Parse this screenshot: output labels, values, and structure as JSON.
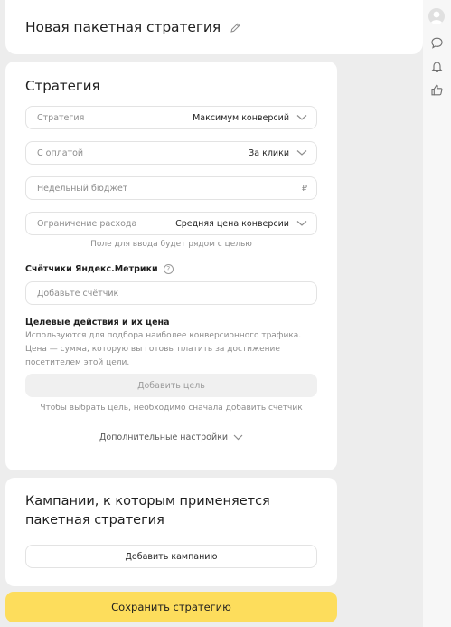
{
  "header": {
    "title": "Новая пакетная стратегия"
  },
  "strategy": {
    "title": "Стратегия",
    "fields": {
      "strategy": {
        "label": "Стратегия",
        "value": "Максимум конверсий"
      },
      "payment": {
        "label": "С оплатой",
        "value": "За клики"
      },
      "budget": {
        "label": "Недельный бюджет",
        "currency": "₽"
      },
      "limit": {
        "label": "Ограничение расхода",
        "value": "Средняя цена конверсии"
      }
    },
    "limit_hint": "Поле для ввода будет рядом с целью",
    "counters": {
      "heading": "Счётчики Яндекс.Метрики",
      "help": "?",
      "placeholder": "Добавьте счётчик"
    },
    "goals": {
      "heading": "Целевые действия и их цена",
      "desc_line1": "Используются для подбора наиболее конверсионного трафика.",
      "desc_line2": "Цена — сумма, которую вы готовы платить за достижение",
      "desc_line3": "посетителем этой цели.",
      "add_button": "Добавить цель",
      "hint": "Чтобы выбрать цель, необходимо сначала добавить счетчик"
    },
    "more_settings": "Дополнительные настройки"
  },
  "campaigns": {
    "title": "Кампании, к которым применяется пакетная стратегия",
    "add_button": "Добавить кампанию"
  },
  "save_button": "Сохранить стратегию",
  "colors": {
    "accent": "#fddd5c",
    "background": "#ededed"
  }
}
